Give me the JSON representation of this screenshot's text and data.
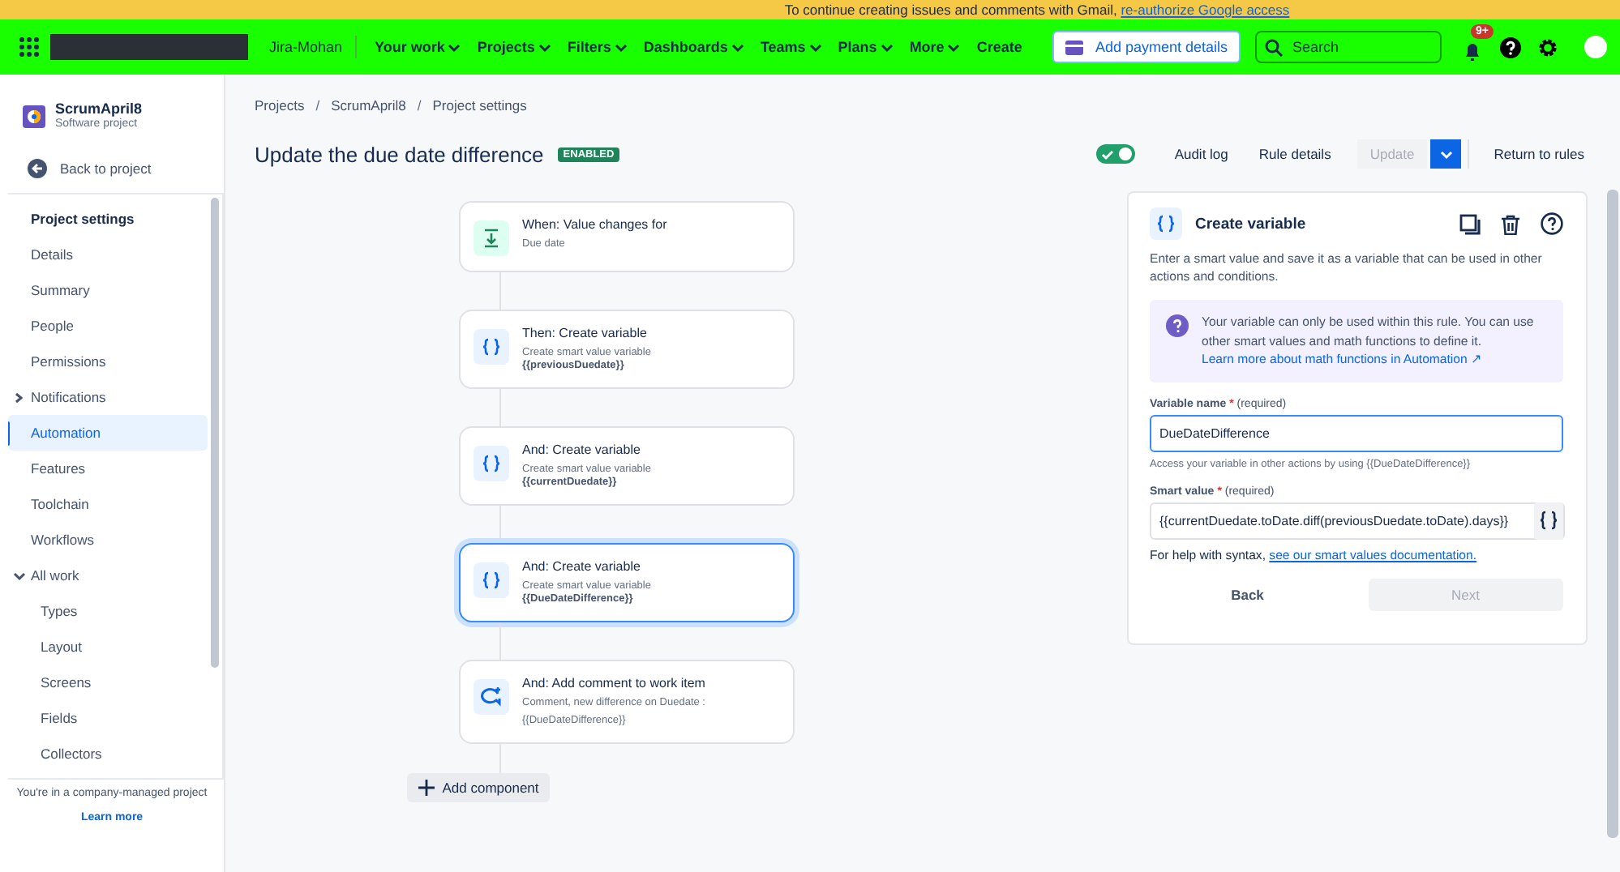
{
  "banner": {
    "text": "To continue creating issues and comments with Gmail, ",
    "link": "re-authorize Google access"
  },
  "nav": {
    "site": "Jira-Mohan",
    "menus": [
      {
        "label": "Your work",
        "dropdown": true
      },
      {
        "label": "Projects",
        "dropdown": true
      },
      {
        "label": "Filters",
        "dropdown": true
      },
      {
        "label": "Dashboards",
        "dropdown": true
      },
      {
        "label": "Teams",
        "dropdown": true
      },
      {
        "label": "Plans",
        "dropdown": true
      },
      {
        "label": "More",
        "dropdown": true
      },
      {
        "label": "Create",
        "dropdown": false
      }
    ],
    "payment_button": "Add payment details",
    "search": {
      "placeholder": "Search"
    },
    "notification_badge": "9+"
  },
  "sidebar": {
    "project": {
      "name": "ScrumApril8",
      "type": "Software project"
    },
    "back": "Back to project",
    "heading": "Project settings",
    "items": [
      {
        "label": "Details",
        "selected": false
      },
      {
        "label": "Summary",
        "selected": false
      },
      {
        "label": "People",
        "selected": false
      },
      {
        "label": "Permissions",
        "selected": false
      },
      {
        "label": "Notifications",
        "selected": false,
        "expanded": false
      },
      {
        "label": "Automation",
        "selected": true
      },
      {
        "label": "Features",
        "selected": false
      },
      {
        "label": "Toolchain",
        "selected": false
      },
      {
        "label": "Workflows",
        "selected": false
      },
      {
        "label": "All work",
        "selected": false,
        "expanded": true,
        "children": [
          {
            "label": "Types",
            "selected": false
          },
          {
            "label": "Layout",
            "selected": false
          },
          {
            "label": "Screens",
            "selected": false
          },
          {
            "label": "Fields",
            "selected": false
          },
          {
            "label": "Collectors",
            "selected": false
          }
        ]
      }
    ],
    "footer": "You're in a company-managed project",
    "footer_link": "Learn more"
  },
  "breadcrumbs": [
    "Projects",
    "ScrumApril8",
    "Project settings"
  ],
  "breadcrumb_separator": "/",
  "rule": {
    "title": "Update the due date difference",
    "status": "ENABLED",
    "enabled": true,
    "actions": [
      "Audit log",
      "Rule details"
    ],
    "update": {
      "label": "Update",
      "disabled": true
    },
    "return": "Return to rules"
  },
  "components": [
    {
      "kind": "trigger",
      "title": "When: Value changes for",
      "detail": "Due date",
      "selected": false
    },
    {
      "kind": "variable",
      "title": "Then: Create variable",
      "detail": "Create smart value variable",
      "value": "{{previousDuedate}}",
      "selected": false
    },
    {
      "kind": "variable",
      "title": "And: Create variable",
      "detail": "Create smart value variable",
      "value": "{{currentDuedate}}",
      "selected": false
    },
    {
      "kind": "variable",
      "title": "And: Create variable",
      "detail": "Create smart value variable",
      "value": "{{DueDateDifference}}",
      "selected": true
    },
    {
      "kind": "comment",
      "title": "And: Add comment to work item",
      "detail": "Comment, new difference on Duedate :",
      "detail2": "{{DueDateDifference}}",
      "selected": false
    }
  ],
  "add_component": "Add component",
  "panel": {
    "title": "Create variable",
    "description": "Enter a smart value and save it as a variable that can be used in other actions and conditions.",
    "info": "Your variable can only be used within this rule. You can use other smart values and math functions to define it.",
    "info_link": "Learn more about math functions in Automation ↗",
    "fields": [
      {
        "label": "Variable name",
        "mark": "*",
        "required": "(required)",
        "value": "DueDateDifference",
        "focused": true,
        "help": "Access your variable in other actions by using {{DueDateDifference}}"
      },
      {
        "label": "Smart value",
        "mark": "*",
        "required": "(required)",
        "value": "{{currentDuedate.toDate.diff(previousDuedate.toDate).days}}",
        "focused": false,
        "help": "For help with syntax, ",
        "help_link": "see our smart values documentation."
      }
    ],
    "back": "Back",
    "next": {
      "label": "Next",
      "disabled": true
    }
  }
}
